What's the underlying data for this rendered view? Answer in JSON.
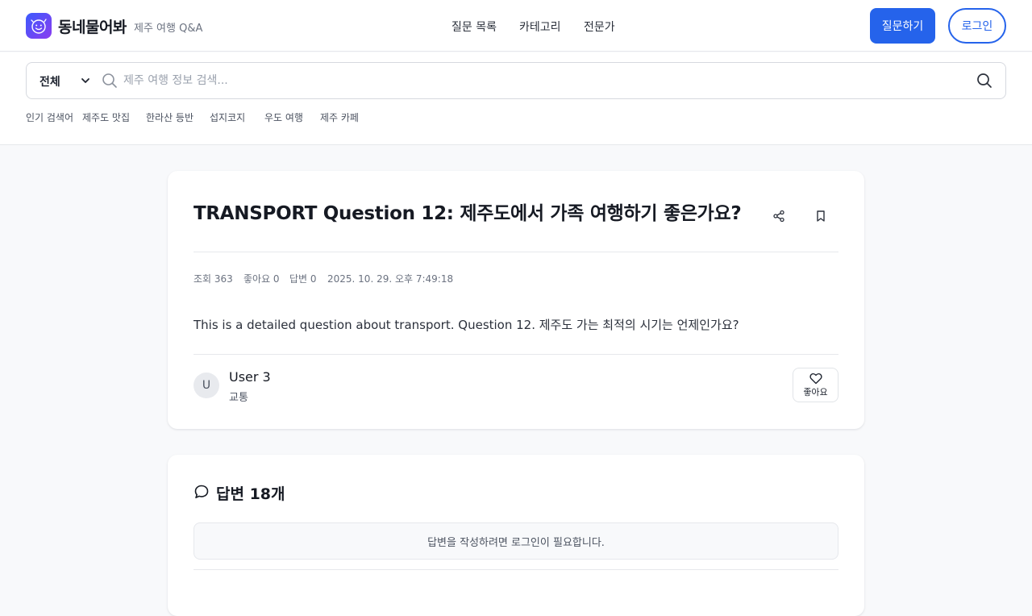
{
  "header": {
    "brand": "동네물어봐",
    "subtitle": "제주 여행 Q&A",
    "nav": [
      "질문 목록",
      "카테고리",
      "전문가"
    ],
    "ask_button": "질문하기",
    "login_button": "로그인"
  },
  "search": {
    "scope": "전체",
    "placeholder": "제주 여행 정보 검색...",
    "popular_label": "인기 검색어",
    "popular_tags": [
      "제주도 맛집",
      "한라산 등반",
      "섭지코지",
      "우도 여행",
      "제주 카페"
    ]
  },
  "question": {
    "title": "TRANSPORT Question 12: 제주도에서 가족 여행하기 좋은가요?",
    "views": "조회 363",
    "likes": "좋아요 0",
    "answers": "답변 0",
    "date": "2025. 10. 29. 오후 7:49:18",
    "body": "This is a detailed question about transport. Question 12. 제주도 가는 최적의 시기는 언제인가요?",
    "author": {
      "initial": "U",
      "name": "User 3",
      "category": "교통"
    },
    "like_button": "좋아요"
  },
  "answers_section": {
    "title": "답변 18개",
    "login_notice": "답변을 작성하려면 로그인이 필요합니다."
  },
  "colors": {
    "accent": "#2563eb",
    "logo_gradient_start": "#3b5bfd",
    "logo_gradient_end": "#8b3cf0"
  }
}
